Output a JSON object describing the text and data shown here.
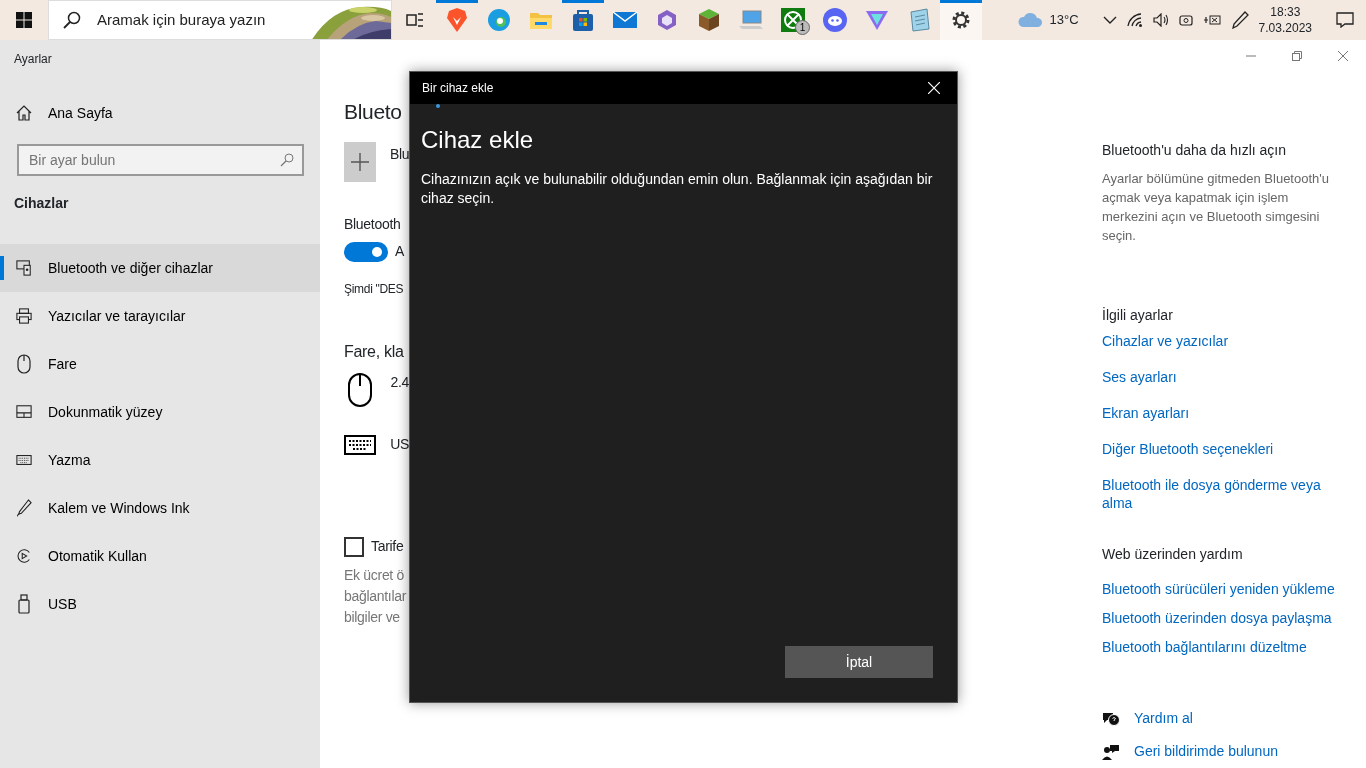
{
  "taskbar": {
    "search_placeholder": "Aramak için buraya yazın",
    "apps": [
      {
        "kind": "taskview",
        "running": false,
        "active": false
      },
      {
        "kind": "brave",
        "running": true,
        "active": false
      },
      {
        "kind": "edge",
        "running": false,
        "active": false
      },
      {
        "kind": "explorer",
        "running": false,
        "active": false
      },
      {
        "kind": "store",
        "running": true,
        "active": false
      },
      {
        "kind": "mail",
        "running": false,
        "active": false
      },
      {
        "kind": "hexagon",
        "running": false,
        "active": false
      },
      {
        "kind": "cube",
        "running": false,
        "active": false
      },
      {
        "kind": "laptop",
        "running": false,
        "active": false
      },
      {
        "kind": "xbox",
        "running": false,
        "active": false,
        "badge": "1"
      },
      {
        "kind": "discord",
        "running": false,
        "active": false
      },
      {
        "kind": "vpn",
        "running": false,
        "active": false
      },
      {
        "kind": "notepad",
        "running": false,
        "active": false
      },
      {
        "kind": "settings",
        "running": true,
        "active": true
      }
    ],
    "weather": "13°C",
    "time": "18:33",
    "date": "7.03.2023"
  },
  "window": {
    "title": "Ayarlar"
  },
  "sidebar": {
    "home": "Ana Sayfa",
    "search_placeholder": "Bir ayar bulun",
    "section": "Cihazlar",
    "items": [
      {
        "kind": "bluetooth",
        "label": "Bluetooth ve diğer cihazlar",
        "selected": true
      },
      {
        "kind": "printer",
        "label": "Yazıcılar ve tarayıcılar",
        "selected": false
      },
      {
        "kind": "mouse",
        "label": "Fare",
        "selected": false
      },
      {
        "kind": "touchpad",
        "label": "Dokunmatik yüzey",
        "selected": false
      },
      {
        "kind": "keyboard",
        "label": "Yazma",
        "selected": false
      },
      {
        "kind": "pen",
        "label": "Kalem ve Windows Ink",
        "selected": false
      },
      {
        "kind": "autoplay",
        "label": "Otomatik Kullan",
        "selected": false
      },
      {
        "kind": "usb",
        "label": "USB",
        "selected": false
      }
    ]
  },
  "main": {
    "heading": "Blueto",
    "add_label": "Blu",
    "bluetooth_label": "Bluetooth",
    "toggle": {
      "on": true,
      "label": "A"
    },
    "status": "Şimdi \"DES",
    "section": "Fare, kla",
    "devices": [
      {
        "kind": "mouse",
        "name": "2.4"
      },
      {
        "kind": "keyboard",
        "name": "US"
      }
    ],
    "metered": {
      "checked": false,
      "label": "Tarife"
    },
    "note_lines": [
      "Ek ücret ö",
      "bağlantılar",
      "bilgiler ve"
    ]
  },
  "right": {
    "quick_title": "Bluetooth'u daha da hızlı açın",
    "quick_text": "Ayarlar bölümüne gitmeden Bluetooth'u açmak veya kapatmak için işlem merkezini açın ve Bluetooth simgesini seçin.",
    "related_title": "İlgili ayarlar",
    "related_links": [
      "Cihazlar ve yazıcılar",
      "Ses ayarları",
      "Ekran ayarları",
      "Diğer Bluetooth seçenekleri",
      "Bluetooth ile dosya gönderme veya alma"
    ],
    "web_title": "Web üzerinden yardım",
    "web_links": [
      "Bluetooth sürücüleri yeniden yükleme",
      "Bluetooth üzerinden dosya paylaşma",
      "Bluetooth bağlantılarını düzeltme"
    ],
    "help_links": [
      {
        "kind": "help",
        "label": "Yardım al"
      },
      {
        "kind": "feedback",
        "label": "Geri bildirimde bulunun"
      }
    ]
  },
  "dialog": {
    "title": "Bir cihaz ekle",
    "heading": "Cihaz ekle",
    "text": "Cihazınızın açık ve bulunabilir olduğundan emin olun. Bağlanmak için aşağıdan bir cihaz seçin.",
    "cancel": "İptal"
  }
}
